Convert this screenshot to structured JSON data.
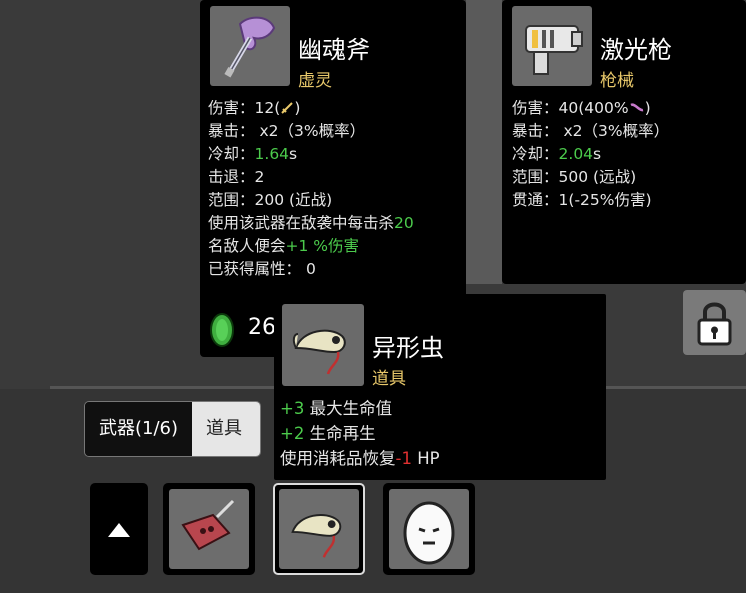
{
  "weapon_card": {
    "name": "幽魂斧",
    "category": "虚灵",
    "icon": "ghost-axe-icon",
    "stats": [
      {
        "label": "伤害",
        "value": "12("
      },
      {
        "label": "暴击",
        "value": "x2（3%概率）"
      },
      {
        "label": "冷却",
        "value": "1.64",
        "unit": "s"
      },
      {
        "label": "击退",
        "value": "2"
      },
      {
        "label": "范围",
        "value": "200 (近战)"
      }
    ],
    "effect_line1_pre": "使用该武器在敌袭中每击杀",
    "effect_line1_num": "20",
    "effect_line2_pre": "名敌人便会",
    "effect_line2_green": "+1 %伤害",
    "gained_label": "已获得属性",
    "gained_value": "0"
  },
  "laser_card": {
    "name": "激光枪",
    "category": "枪械",
    "icon": "laser-gun-icon",
    "stats": [
      {
        "label": "伤害",
        "value": "40(400%"
      },
      {
        "label": "暴击",
        "value": "x2（3%概率）"
      },
      {
        "label": "冷却",
        "value": "2.04",
        "unit": "s"
      },
      {
        "label": "范围",
        "value": "500 (远战)"
      },
      {
        "label": "贯通",
        "value": "1(-25%伤害)"
      }
    ]
  },
  "item_card": {
    "name": "异形虫",
    "category": "道具",
    "icon": "alien-worm-icon",
    "line1_green": "+3",
    "line1_text": " 最大生命值",
    "line2_green": "+2",
    "line2_text": " 生命再生",
    "line3_pre": "使用消耗品恢复",
    "line3_red": "-1",
    "line3_post": " HP"
  },
  "materials": {
    "count": "26"
  },
  "tabs": {
    "weapons": "武器(1/6)",
    "items": "道具"
  },
  "inventory_slots": [
    {
      "icon": "meat-knife-icon"
    },
    {
      "icon": "alien-worm-icon",
      "selected": true
    },
    {
      "icon": "egg-face-icon"
    }
  ],
  "colors": {
    "green": "#4ccb4c",
    "red": "#e03030",
    "gold": "#e8c86a"
  }
}
